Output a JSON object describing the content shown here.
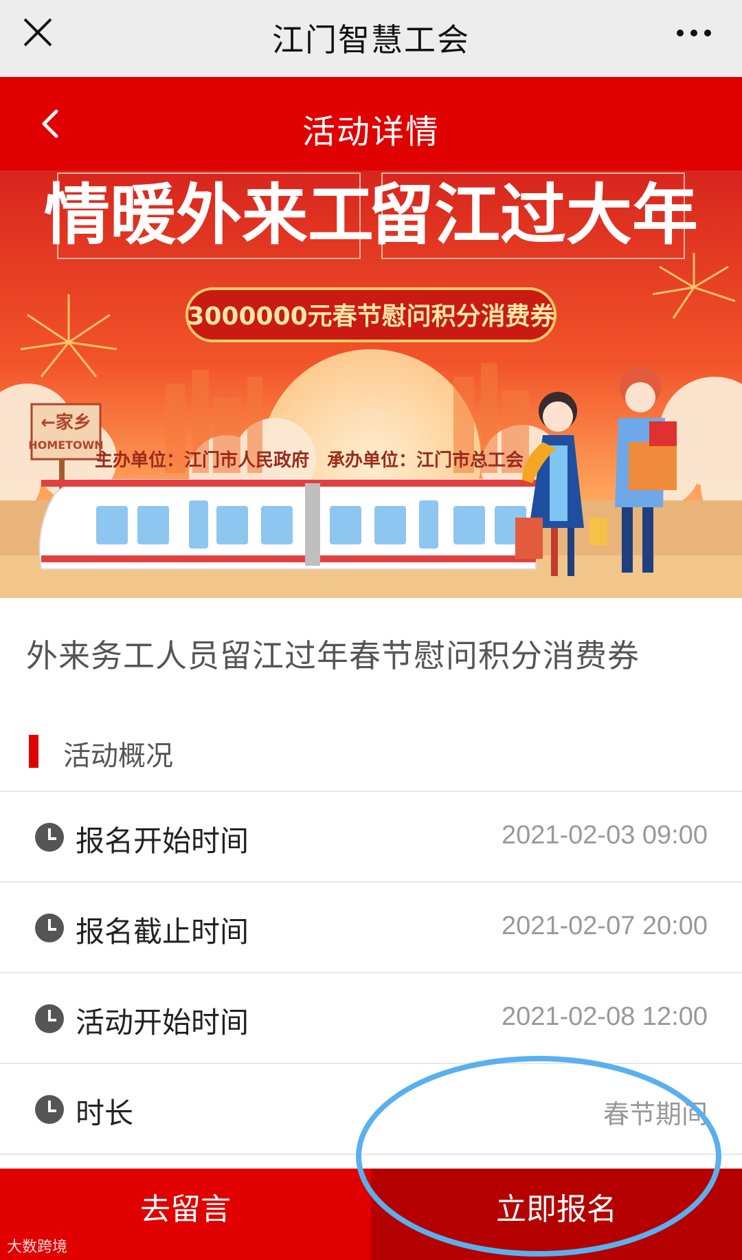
{
  "wechat": {
    "title": "江门智慧工会",
    "close_icon": "close-icon",
    "more_icon": "more-dots-icon"
  },
  "header": {
    "title": "活动详情",
    "back_icon": "chevron-left-icon"
  },
  "banner": {
    "headline_left": "情暖外来工",
    "headline_right": "留江过大年",
    "pill_text": "3000000元春节慰问积分消费券",
    "sign_cn": "←家乡",
    "sign_en": "HOMETOWN",
    "organizers": "主办单位：江门市人民政府　承办单位：江门市总工会"
  },
  "activity": {
    "title": "外来务工人员留江过年春节慰问积分消费券"
  },
  "section": {
    "label": "活动概况"
  },
  "rows": [
    {
      "label": "报名开始时间",
      "value": "2021-02-03 09:00",
      "icon": "clock-icon"
    },
    {
      "label": "报名截止时间",
      "value": "2021-02-07 20:00",
      "icon": "clock-icon"
    },
    {
      "label": "活动开始时间",
      "value": "2021-02-08 12:00",
      "icon": "clock-icon"
    },
    {
      "label": "时长",
      "value": "春节期间",
      "icon": "clock-icon"
    }
  ],
  "actions": {
    "message_label": "去留言",
    "signup_label": "立即报名"
  },
  "watermark": "大数跨境",
  "colors": {
    "primary_red": "#e00000",
    "dark_red": "#b50000",
    "highlight_blue": "#5ab0ef"
  }
}
